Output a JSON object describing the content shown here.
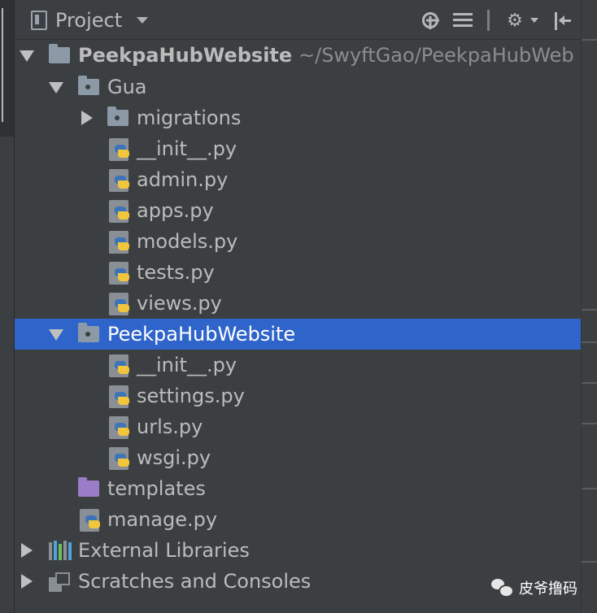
{
  "header": {
    "title": "Project"
  },
  "tree": {
    "root": {
      "label": "PeekpaHubWebsite",
      "path": "~/SwyftGao/PeekpaHubWeb"
    },
    "gua": {
      "label": "Gua",
      "children": [
        "migrations",
        "__init__.py",
        "admin.py",
        "apps.py",
        "models.py",
        "tests.py",
        "views.py"
      ]
    },
    "pkg": {
      "label": "PeekpaHubWebsite",
      "children": [
        "__init__.py",
        "settings.py",
        "urls.py",
        "wsgi.py"
      ]
    },
    "templates": "templates",
    "manage": "manage.py",
    "external_libraries": "External Libraries",
    "scratches": "Scratches and Consoles"
  },
  "colors": {
    "selection": "#2f65ca",
    "background": "#3c3f41",
    "templates_folder": "#9b7cc8"
  },
  "watermark": {
    "text": "皮爷撸码"
  }
}
